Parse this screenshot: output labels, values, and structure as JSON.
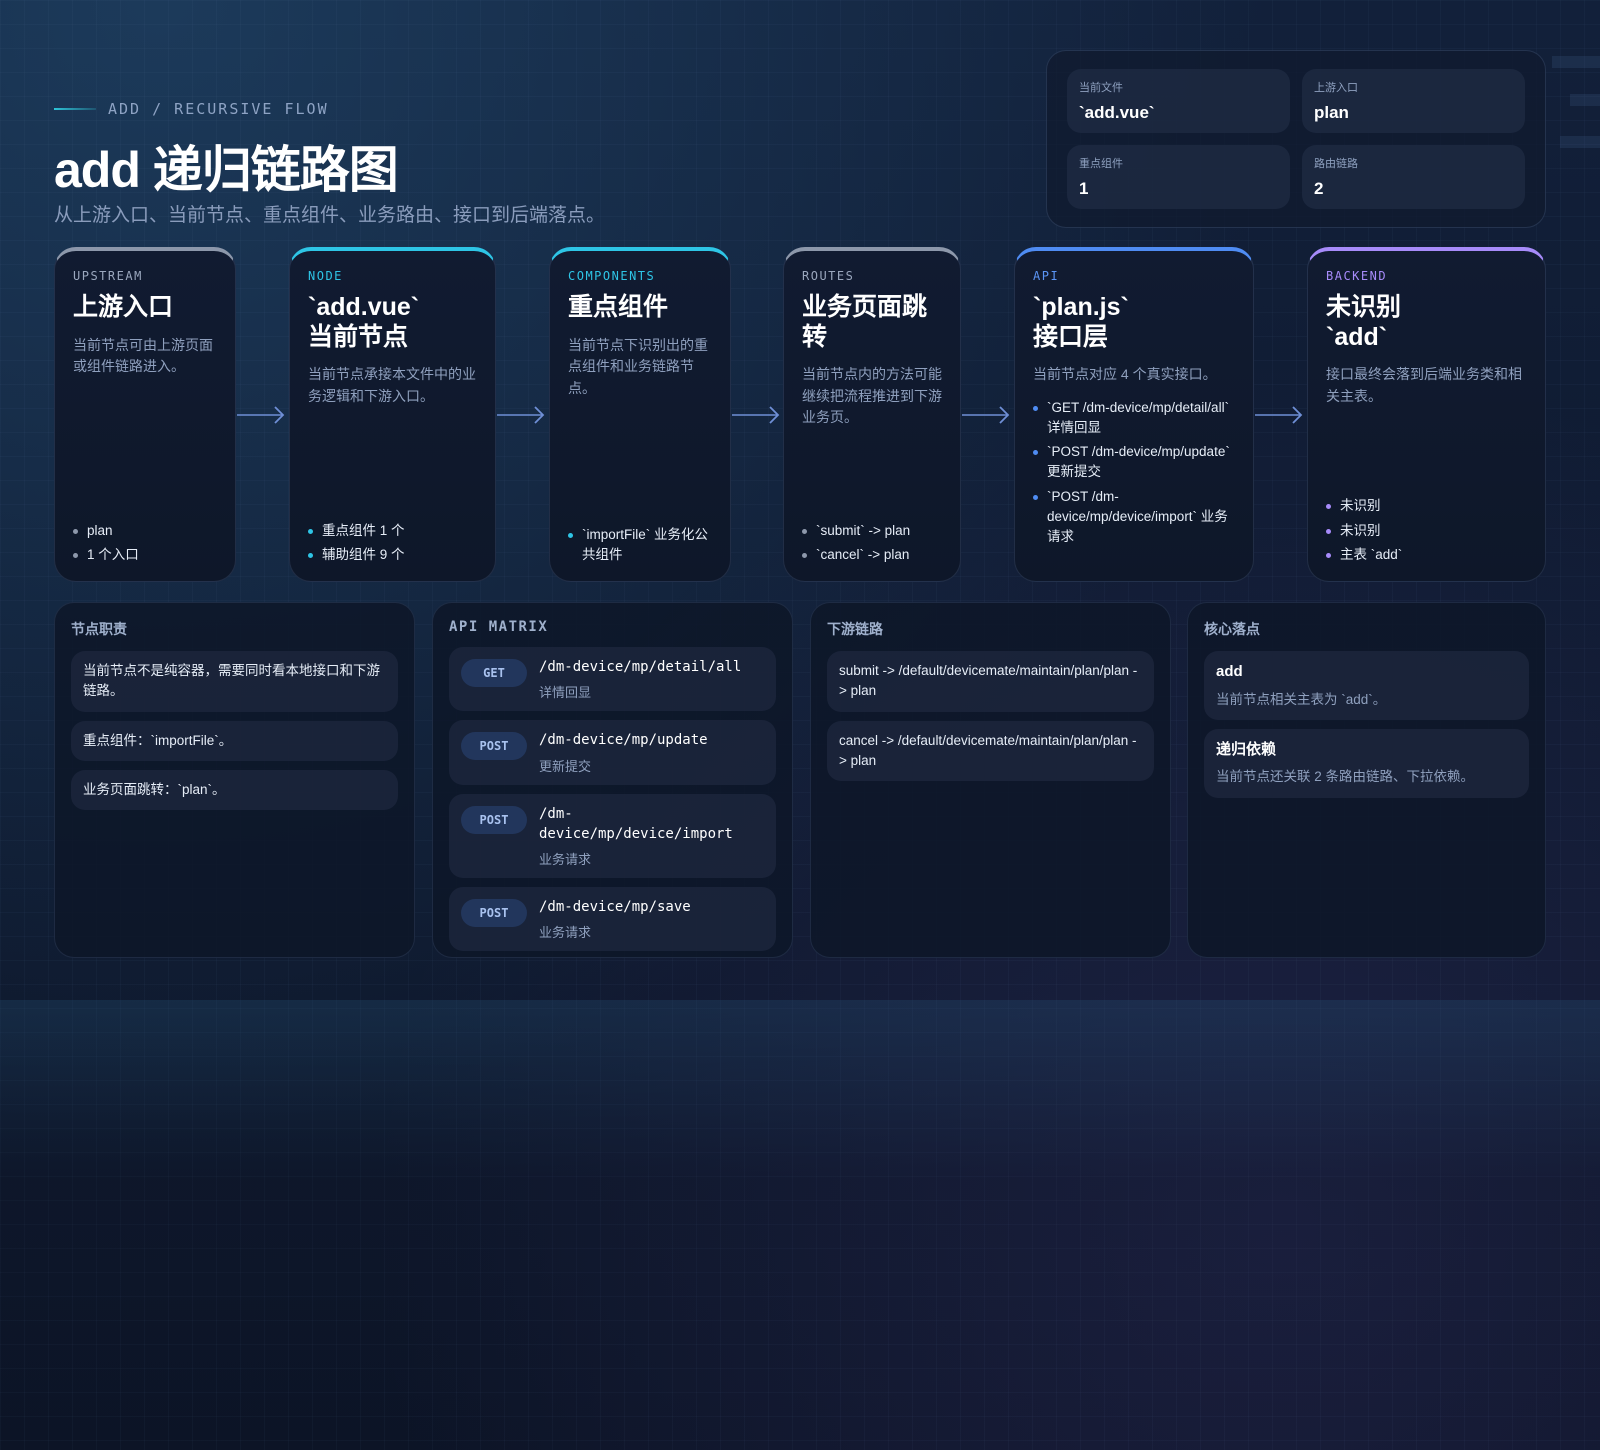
{
  "header": {
    "kicker": "ADD / RECURSIVE FLOW",
    "title": "add 递归链路图",
    "subtitle": "从上游入口、当前节点、重点组件、业务路由、接口到后端落点。"
  },
  "stats": [
    {
      "label": "当前文件",
      "value": "`add.vue`"
    },
    {
      "label": "上游入口",
      "value": "plan"
    },
    {
      "label": "重点组件",
      "value": "1"
    },
    {
      "label": "路由链路",
      "value": "2"
    }
  ],
  "flow": [
    {
      "tag": "UPSTREAM",
      "title": "上游入口",
      "desc": "当前节点可由上游页面或组件链路进入。",
      "items": [
        "plan",
        "1 个入口"
      ]
    },
    {
      "tag": "NODE",
      "title": "`add.vue`\n当前节点",
      "desc": "当前节点承接本文件中的业务逻辑和下游入口。",
      "items": [
        "重点组件 1 个",
        "辅助组件 9 个"
      ]
    },
    {
      "tag": "COMPONENTS",
      "title": "重点组件",
      "desc": "当前节点下识别出的重点组件和业务链路节点。",
      "items": [
        "`importFile` 业务化公共组件"
      ]
    },
    {
      "tag": "ROUTES",
      "title": "业务页面跳\n转",
      "desc": "当前节点内的方法可能继续把流程推进到下游业务页。",
      "items": [
        "`submit` -> plan",
        "`cancel` -> plan"
      ]
    },
    {
      "tag": "API",
      "title": "`plan.js`\n接口层",
      "desc": "当前节点对应 4 个真实接口。",
      "items": [
        "`GET /dm-device/mp/detail/all` 详情回显",
        "`POST /dm-device/mp/update` 更新提交",
        "`POST /dm-device/mp/device/import` 业务请求"
      ]
    },
    {
      "tag": "BACKEND",
      "title": "未识别\n`add`",
      "desc": "接口最终会落到后端业务类和相关主表。",
      "items": [
        "未识别",
        "未识别",
        "主表 `add`"
      ]
    }
  ],
  "panels": {
    "duties": {
      "title": "节点职责",
      "items": [
        "当前节点不是纯容器，需要同时看本地接口和下游链路。",
        "重点组件：`importFile`。",
        "业务页面跳转：`plan`。"
      ]
    },
    "api_matrix": {
      "title": "API MATRIX",
      "rows": [
        {
          "method": "GET",
          "path": "/dm-device/mp/detail/all",
          "desc": "详情回显"
        },
        {
          "method": "POST",
          "path": "/dm-device/mp/update",
          "desc": "更新提交"
        },
        {
          "method": "POST",
          "path": "/dm-device/mp/device/import",
          "desc": "业务请求"
        },
        {
          "method": "POST",
          "path": "/dm-device/mp/save",
          "desc": "业务请求"
        }
      ]
    },
    "downstream": {
      "title": "下游链路",
      "items": [
        "submit -> /default/devicemate/maintain/plan/plan -> plan",
        "cancel -> /default/devicemate/maintain/plan/plan -> plan"
      ]
    },
    "core": {
      "title": "核心落点",
      "items": [
        {
          "title": "add",
          "desc": "当前节点相关主表为 `add`。"
        },
        {
          "title": "递归依赖",
          "desc": "当前节点还关联 2 条路由链路、下拉依赖。"
        }
      ]
    }
  },
  "colors": {
    "gray": "#8d98ab",
    "cyan": "#2ec5e6",
    "blue": "#4f8cf3",
    "purple": "#a78bfa",
    "arrow": "#6f8fd6"
  },
  "icons": {
    "flow_arrow": "arrow-right-icon",
    "bullet": "dot-icon"
  }
}
